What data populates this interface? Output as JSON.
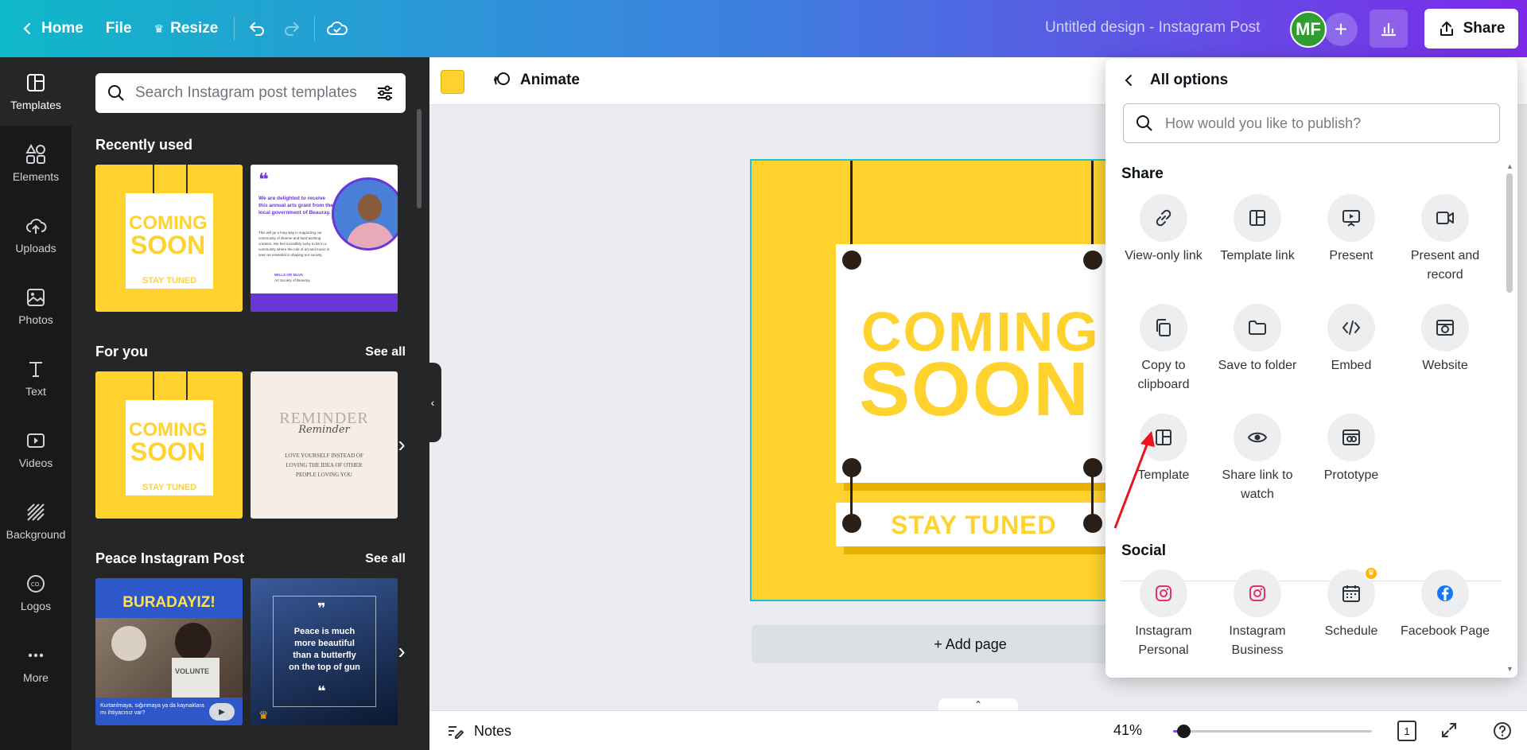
{
  "topbar": {
    "home_label": "Home",
    "file_label": "File",
    "resize_label": "Resize",
    "doc_title": "Untitled design - Instagram Post",
    "avatar_initials": "MF",
    "share_label": "Share",
    "gradient_start": "#0fb8c9",
    "gradient_end": "#7d2ae8"
  },
  "rail": {
    "items": [
      {
        "label": "Templates",
        "icon": "templates-icon"
      },
      {
        "label": "Elements",
        "icon": "elements-icon"
      },
      {
        "label": "Uploads",
        "icon": "cloud-upload-icon"
      },
      {
        "label": "Photos",
        "icon": "image-icon"
      },
      {
        "label": "Text",
        "icon": "text-icon"
      },
      {
        "label": "Videos",
        "icon": "video-icon"
      },
      {
        "label": "Background",
        "icon": "background-icon"
      },
      {
        "label": "Logos",
        "icon": "logo-icon"
      },
      {
        "label": "More",
        "icon": "more-dots-icon"
      }
    ]
  },
  "panel": {
    "search_placeholder": "Search Instagram post templates",
    "recently_used": "Recently used",
    "for_you": "For you",
    "peace_title": "Peace Instagram Post",
    "see_all": "See all",
    "thumb_cs_line1": "COMING",
    "thumb_cs_line2": "SOON",
    "thumb_cs_line3": "STAY TUNED",
    "thumb_quote_text": "We are delighted to receive this annual arts grant from the local government of Beauray.",
    "thumb_quote_small": "This will go a long way in supporting our community of diverse and hard working creators. We feel incredibly lucky to be in a community where the role of art and music is seen as essential in shaping our society.",
    "thumb_quote_sig": "WILLS OR SILVA",
    "thumb_quote_org": "Art Society of Beauray",
    "thumb_reminder_title": "REMINDER",
    "thumb_reminder_script": "Reminder",
    "thumb_reminder_body": "LOVE YOURSELF INSTEAD OF LOVING THE IDEA OF OTHER PEOPLE LOVING YOU",
    "thumb_peace1_title": "BURADAYIZ!",
    "thumb_peace1_caption": "Kurtarılmaya, sığınmaya ya da kaynaklara mı ihtiyacınız var?",
    "thumb_peace1_shirt": "VOLUNTE",
    "thumb_peace2_quote": "Peace is much more beautiful than a butterfly on the top of gun"
  },
  "editor": {
    "animate_label": "Animate",
    "swatch_color": "#ffd22e",
    "design_line1": "COMING",
    "design_line2": "SOON",
    "design_line3": "STAY TUNED",
    "add_page_label": "+ Add page"
  },
  "share_menu": {
    "back_label": "All options",
    "search_placeholder": "How would you like to publish?",
    "share_section": "Share",
    "social_section": "Social",
    "share_options": [
      {
        "label": "View-only link",
        "icon": "link-icon"
      },
      {
        "label": "Template link",
        "icon": "template-layout-icon"
      },
      {
        "label": "Present",
        "icon": "present-icon"
      },
      {
        "label": "Present and record",
        "icon": "record-icon"
      },
      {
        "label": "Copy to clipboard",
        "icon": "copy-icon"
      },
      {
        "label": "Save to folder",
        "icon": "folder-icon"
      },
      {
        "label": "Embed",
        "icon": "code-icon"
      },
      {
        "label": "Website",
        "icon": "website-icon"
      },
      {
        "label": "Template",
        "icon": "template-layout-icon"
      },
      {
        "label": "Share link to watch",
        "icon": "eye-icon"
      },
      {
        "label": "Prototype",
        "icon": "prototype-icon"
      }
    ],
    "social_options": [
      {
        "label": "Instagram Personal",
        "icon": "instagram-icon"
      },
      {
        "label": "Instagram Business",
        "icon": "instagram-icon"
      },
      {
        "label": "Schedule",
        "icon": "calendar-icon",
        "premium": true
      },
      {
        "label": "Facebook Page",
        "icon": "facebook-icon"
      }
    ]
  },
  "bottombar": {
    "notes_label": "Notes",
    "zoom_label": "41%",
    "zoom_fraction": 0.05,
    "page_count": "1"
  }
}
